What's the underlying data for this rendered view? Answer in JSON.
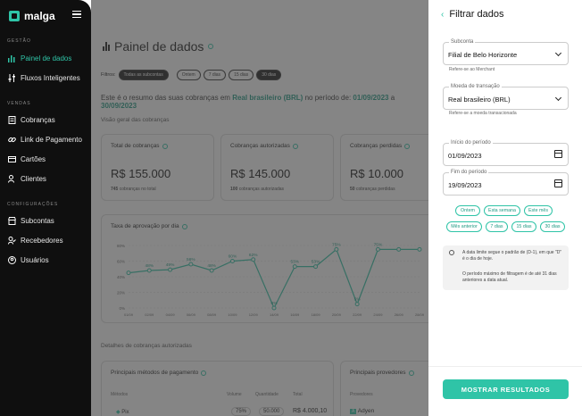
{
  "sidebar": {
    "logo": "malga",
    "sections": [
      "GESTÃO",
      "VENDAS",
      "CONFIGURAÇÕES"
    ],
    "items": [
      {
        "label": "Painel de dados",
        "icon": "bar-chart-icon",
        "active": true
      },
      {
        "label": "Fluxos Inteligentes",
        "icon": "sliders-icon"
      },
      {
        "label": "Cobranças",
        "icon": "receipt-icon"
      },
      {
        "label": "Link de Pagamento",
        "icon": "link-icon"
      },
      {
        "label": "Cartões",
        "icon": "card-icon"
      },
      {
        "label": "Clientes",
        "icon": "users-icon"
      },
      {
        "label": "Subcontas",
        "icon": "store-icon"
      },
      {
        "label": "Recebedores",
        "icon": "user-check-icon"
      },
      {
        "label": "Usuários",
        "icon": "user-circle-icon"
      }
    ]
  },
  "main": {
    "title": "Painel de dados",
    "filters_label": "Filtros:",
    "filter_chips": [
      "Todas as subcontas",
      "Ontem",
      "7 dias",
      "15 dias",
      "30 dias"
    ],
    "summary": {
      "prefix": "Este é o resumo das suas cobranças em",
      "currency": "Real brasileiro (BRL)",
      "middle": "no período de:",
      "start": "01/09/2023",
      "joiner": "a",
      "end": "30/09/2023"
    },
    "overview_label": "Visão geral das cobranças",
    "cards": [
      {
        "title": "Total de cobranças",
        "value": "R$ 155.000",
        "count": "745",
        "count_suffix": "cobranças no total"
      },
      {
        "title": "Cobranças autorizadas",
        "value": "R$ 145.000",
        "count": "100",
        "count_suffix": "cobranças autorizadas"
      },
      {
        "title": "Cobranças perdidas",
        "value": "R$ 10.000",
        "count": "50",
        "count_suffix": "cobranças perdidas"
      }
    ],
    "details_label": "Detalhes de cobranças autorizadas",
    "methods_card": {
      "title": "Principais métodos de pagamento",
      "headers": [
        "Métodos",
        "Volume",
        "Quantidade",
        "Total"
      ],
      "row": {
        "method": "Pix",
        "volume": "75%",
        "quantity": "50.000",
        "total": "R$ 4.000,10"
      }
    },
    "providers_card": {
      "title": "Principais provedores",
      "headers": [
        "Provedores"
      ],
      "row": {
        "provider": "Adyen"
      }
    }
  },
  "chart_data": {
    "type": "line",
    "title": "Taxa de aprovação por dia",
    "x": [
      "01/09",
      "02/09",
      "04/09",
      "06/09",
      "08/09",
      "10/09",
      "12/09",
      "14/09",
      "16/09",
      "18/09",
      "20/09",
      "22/09",
      "24/09",
      "26/09",
      "28/09"
    ],
    "values": [
      45,
      48,
      49,
      56,
      48,
      60,
      62,
      0,
      53,
      53,
      75,
      5,
      75,
      75,
      75
    ],
    "point_labels": [
      "",
      "48%",
      "49%",
      "56%",
      "48%",
      "60%",
      "62%",
      "0%",
      "53%",
      "53%",
      "75%",
      "5%",
      "75%",
      "",
      ""
    ],
    "y_ticks": [
      "0%",
      "20%",
      "40%",
      "60%",
      "80%"
    ],
    "ylim": [
      0,
      80
    ],
    "grid": true,
    "series_color": "#2fc4a7"
  },
  "panel": {
    "title": "Filtrar dados",
    "subconta": {
      "label": "Subconta",
      "value": "Filial de Belo Horizonte",
      "hint": "Refere-se ao Merchant"
    },
    "moeda": {
      "label": "Moeda de transação",
      "value": "Real brasileiro (BRL)",
      "hint": "Refere-se a moeda transacionada"
    },
    "inicio": {
      "label": "Início do período",
      "value": "01/09/2023"
    },
    "fim": {
      "label": "Fim do período",
      "value": "19/09/2023"
    },
    "quick_ranges": [
      "Ontem",
      "Esta semana",
      "Este mês",
      "Mês anterior",
      "7 dias",
      "15 dias",
      "30 dias"
    ],
    "notes": [
      "A data limite segue o padrão de (D-1), em que \"D\" é o dia de hoje.",
      "O período máximo de filtragem é de até 31 dias anteriores a data atual."
    ],
    "cta": "MOSTRAR RESULTADOS"
  }
}
